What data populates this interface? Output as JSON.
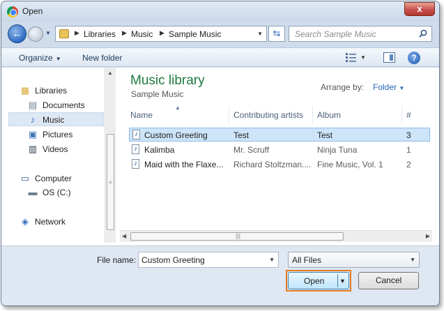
{
  "window": {
    "title": "Open",
    "close_label": "x"
  },
  "nav": {
    "back_glyph": "←",
    "forward_glyph": "→",
    "breadcrumb": [
      "Libraries",
      "Music",
      "Sample Music"
    ],
    "search_placeholder": "Search Sample Music"
  },
  "toolbar": {
    "organize_label": "Organize",
    "new_folder_label": "New folder",
    "help_label": "?"
  },
  "sidebar": {
    "items": [
      {
        "label": "Libraries",
        "icon": "libraries-icon",
        "selected": false
      },
      {
        "label": "Documents",
        "icon": "documents-icon",
        "selected": false
      },
      {
        "label": "Music",
        "icon": "music-note-icon",
        "selected": true
      },
      {
        "label": "Pictures",
        "icon": "pictures-icon",
        "selected": false
      },
      {
        "label": "Videos",
        "icon": "videos-icon",
        "selected": false
      },
      {
        "label": "Computer",
        "icon": "computer-icon",
        "selected": false
      },
      {
        "label": "OS (C:)",
        "icon": "drive-icon",
        "selected": false
      },
      {
        "label": "Network",
        "icon": "network-icon",
        "selected": false
      }
    ]
  },
  "library": {
    "title": "Music library",
    "subtitle": "Sample Music",
    "arrange_label": "Arrange by:",
    "arrange_value": "Folder"
  },
  "table": {
    "columns": [
      "Name",
      "Contributing artists",
      "Album",
      "#"
    ],
    "rows": [
      {
        "name": "Custom Greeting",
        "artist": "Test",
        "album": "Test",
        "track": "3",
        "selected": true
      },
      {
        "name": "Kalimba",
        "artist": "Mr. Scruff",
        "album": "Ninja Tuna",
        "track": "1",
        "selected": false
      },
      {
        "name": "Maid with the Flaxe...",
        "artist": "Richard Stoltzman....",
        "album": "Fine Music, Vol. 1",
        "track": "2",
        "selected": false
      }
    ]
  },
  "footer": {
    "filename_label": "File name:",
    "filename_value": "Custom Greeting",
    "filter_value": "All Files",
    "open_label": "Open",
    "cancel_label": "Cancel"
  },
  "colors": {
    "library_title": "#1e7a3e",
    "accent_blue": "#2866b4",
    "focus_orange": "#e27c24"
  }
}
